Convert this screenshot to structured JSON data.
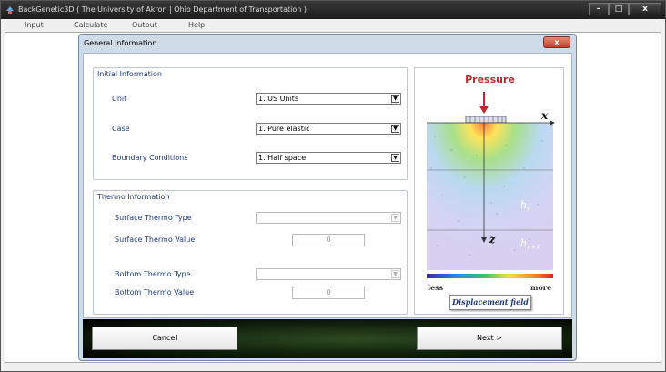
{
  "window": {
    "title": "BackGenetic3D  ( The University of Akron  |  Ohio Department of Transportation )",
    "minimize": "–",
    "maximize": "□",
    "close": "x"
  },
  "menu": [
    {
      "label": "Input"
    },
    {
      "label": "Calculate"
    },
    {
      "label": "Output"
    },
    {
      "label": "Help"
    }
  ],
  "dialog": {
    "title": "General Information",
    "close": "x",
    "initial": {
      "title": "Initial Information",
      "unit_label": "Unit",
      "unit_value": "1. US Units",
      "case_label": "Case",
      "case_value": "1. Pure elastic",
      "boundary_label": "Boundary Conditions",
      "boundary_value": "1. Half space"
    },
    "thermo": {
      "title": "Thermo Information",
      "surface_type_label": "Surface Thermo Type",
      "surface_type_value": "",
      "surface_value_label": "Surface Thermo Value",
      "surface_value": "0",
      "bottom_type_label": "Bottom Thermo Type",
      "bottom_type_value": "",
      "bottom_value_label": "Bottom Thermo Value",
      "bottom_value": "0"
    },
    "figure": {
      "title": "Pressure",
      "x_axis": "x",
      "z_axis": "z",
      "layer_n": "h",
      "layer_n_sub": "n",
      "layer_n1": "h",
      "layer_n1_sub": "n+1",
      "less": "less",
      "more": "more",
      "caption": "Displacement field"
    },
    "cancel": "Cancel",
    "next": "Next >"
  },
  "colors": {
    "group_label": "#1f3a80",
    "pressure_red": "#c0262b",
    "dialog_frame": "#cfdbe9"
  }
}
